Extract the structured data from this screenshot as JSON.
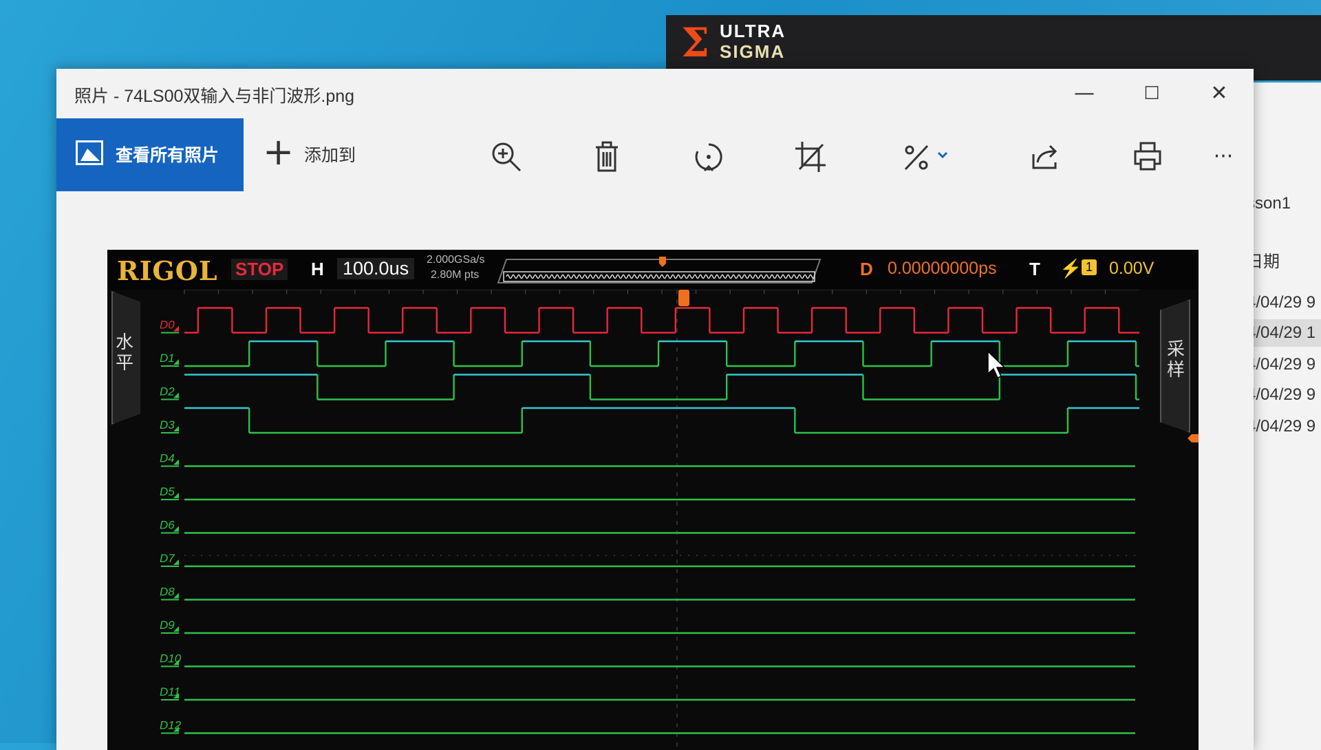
{
  "background_app": {
    "logo_line1": "ULTRA",
    "logo_line2": "SIGMA"
  },
  "side_panel": {
    "header_partial": "sson1",
    "date_label": "日期",
    "dates": [
      "4/04/29 9",
      "4/04/29 1",
      "4/04/29 9",
      "4/04/29 9",
      "4/04/29 9"
    ]
  },
  "window": {
    "title": "照片 - 74LS00双输入与非门波形.png",
    "controls": {
      "minimize": "—",
      "maximize": "☐",
      "close": "✕"
    }
  },
  "toolbar": {
    "view_all_label": "查看所有照片",
    "add_to_label": "添加到",
    "icons": [
      "zoom-in-icon",
      "delete-icon",
      "rotate-icon",
      "crop-icon",
      "edit-icon",
      "share-icon",
      "print-icon",
      "more-icon"
    ],
    "more_label": "···"
  },
  "scope": {
    "brand": "RIGOL",
    "run_state": "STOP",
    "h_label": "H",
    "timebase": "100.0us",
    "sample_rate": "2.000GSa/s",
    "memory_depth": "2.80M pts",
    "d_label": "D",
    "delay": "0.00000000ps",
    "t_label": "T",
    "trigger_source": "1",
    "trigger_level": "0.00V",
    "left_tab": "水平",
    "right_tab": "采样",
    "channels": [
      "D0",
      "D1",
      "D2",
      "D3",
      "D4",
      "D5",
      "D6",
      "D7",
      "D8",
      "D9",
      "D10",
      "D11",
      "D12"
    ],
    "colors": {
      "d0": "#e8283a",
      "high": "#35c8d0",
      "low": "#2fc24a",
      "accent": "#f07020",
      "brand": "#e8b43a"
    },
    "divisions_per_channel_period": {
      "D0": 1,
      "D1": 2,
      "D2": 4,
      "D3": 8
    }
  }
}
